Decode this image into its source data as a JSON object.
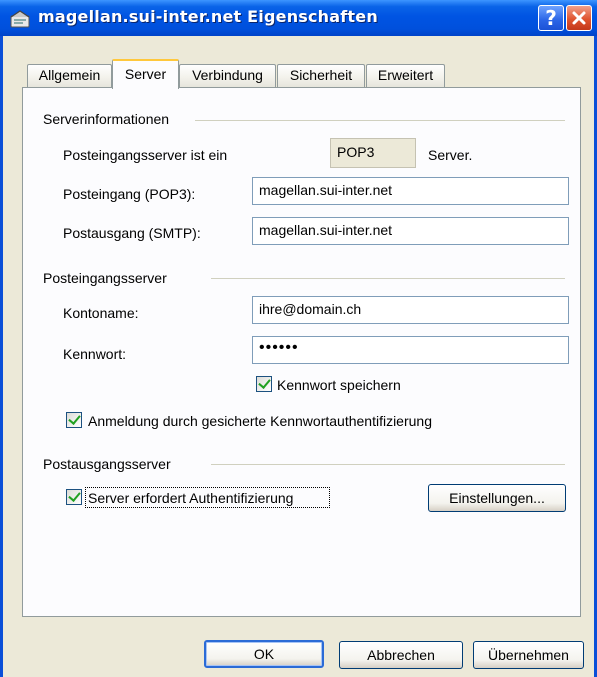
{
  "window": {
    "title": "magellan.sui-inter.net Eigenschaften",
    "help_label": "?",
    "close_label": "✕"
  },
  "tabs": [
    {
      "label": "Allgemein"
    },
    {
      "label": "Server",
      "active": true
    },
    {
      "label": "Verbindung"
    },
    {
      "label": "Sicherheit"
    },
    {
      "label": "Erweitert"
    }
  ],
  "server_info": {
    "heading": "Serverinformationen",
    "incoming_type_label": "Posteingangsserver ist ein",
    "incoming_type_value": "POP3",
    "incoming_type_suffix": "Server.",
    "incoming_label": "Posteingang (POP3):",
    "incoming_value": "magellan.sui-inter.net",
    "outgoing_label": "Postausgang (SMTP):",
    "outgoing_value": "magellan.sui-inter.net"
  },
  "incoming_server": {
    "heading": "Posteingangsserver",
    "account_label": "Kontoname:",
    "account_value": "ihre@domain.ch",
    "password_label": "Kennwort:",
    "password_value": "••••••",
    "remember_password_label": "Kennwort speichern",
    "remember_password_checked": true,
    "spa_label": "Anmeldung durch gesicherte Kennwortauthentifizierung",
    "spa_checked": true
  },
  "outgoing_server": {
    "heading": "Postausgangsserver",
    "auth_label": "Server erfordert Authentifizierung",
    "auth_checked": true,
    "settings_button": "Einstellungen..."
  },
  "footer": {
    "ok_label": "OK",
    "cancel_label": "Abbrechen",
    "apply_label": "Übernehmen"
  },
  "colors": {
    "titlebar": "#0054e3",
    "dialog_bg": "#ece9d8",
    "panel_bg": "#fcfcfe",
    "check_mark": "#21a121",
    "active_tab_accent": "#ffc83c"
  }
}
